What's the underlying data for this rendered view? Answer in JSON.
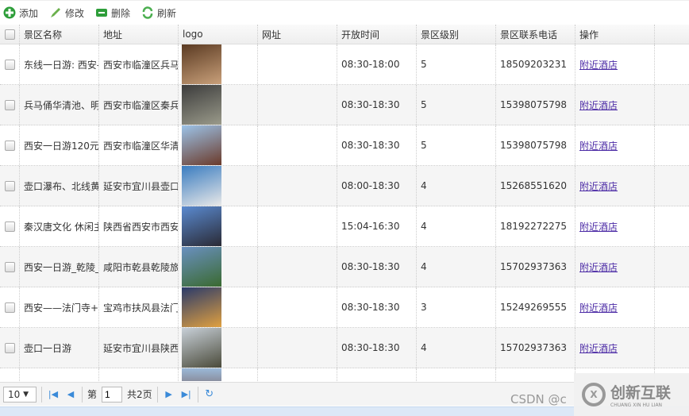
{
  "toolbar": {
    "add": "添加",
    "edit": "修改",
    "delete": "删除",
    "refresh": "刷新"
  },
  "columns": [
    "景区名称",
    "地址",
    "logo",
    "网址",
    "开放时间",
    "景区级别",
    "景区联系电话",
    "操作"
  ],
  "rows": [
    {
      "name": "东线一日游: 西安-",
      "address": "西安市临潼区兵马",
      "url": "",
      "hours": "08:30-18:00",
      "level": "5",
      "phone": "18509203231",
      "op": "附近酒店",
      "logo": [
        "#5a3a22",
        "#c9a07a"
      ]
    },
    {
      "name": "兵马俑华清池、明",
      "address": "西安市临潼区秦兵",
      "url": "",
      "hours": "08:30-18:30",
      "level": "5",
      "phone": "15398075798",
      "op": "附近酒店",
      "logo": [
        "#3c3c3c",
        "#9a9a8a"
      ]
    },
    {
      "name": "西安一日游120元,",
      "address": "西安市临潼区华清",
      "url": "",
      "hours": "08:30-18:30",
      "level": "5",
      "phone": "15398075798",
      "op": "附近酒店",
      "logo": [
        "#9cc3e8",
        "#6b3a2a"
      ]
    },
    {
      "name": "壶口瀑布、北线黄",
      "address": "延安市宜川县壶口",
      "url": "",
      "hours": "08:00-18:30",
      "level": "4",
      "phone": "15268551620",
      "op": "附近酒店",
      "logo": [
        "#3a7cc0",
        "#e8e8e8"
      ]
    },
    {
      "name": "秦汉唐文化 休闲主",
      "address": "陕西省西安市西安",
      "url": "",
      "hours": "15:04-16:30",
      "level": "4",
      "phone": "18192272275",
      "op": "附近酒店",
      "logo": [
        "#5a8ad0",
        "#2a2a35"
      ]
    },
    {
      "name": "西安一日游_乾陵_",
      "address": "咸阳市乾县乾陵旅",
      "url": "",
      "hours": "08:30-18:30",
      "level": "4",
      "phone": "15702937363",
      "op": "附近酒店",
      "logo": [
        "#6a90c0",
        "#3a6a30"
      ]
    },
    {
      "name": "西安——法门寺+",
      "address": "宝鸡市扶风县法门",
      "url": "",
      "hours": "08:30-18:30",
      "level": "3",
      "phone": "15249269555",
      "op": "附近酒店",
      "logo": [
        "#2a3a6a",
        "#e0a040"
      ]
    },
    {
      "name": "壶口一日游",
      "address": "延安市宜川县陕西",
      "url": "",
      "hours": "08:30-18:30",
      "level": "4",
      "phone": "15702937363",
      "op": "附近酒店",
      "logo": [
        "#c8d0d8",
        "#4a4a3a"
      ]
    }
  ],
  "pager": {
    "page_size": "10",
    "page_prefix": "第",
    "page": "1",
    "total": "共2页"
  },
  "watermark": "CSDN @c",
  "brand": {
    "name": "创新互联",
    "sub": "CHUANG XIN HU LIAN"
  }
}
